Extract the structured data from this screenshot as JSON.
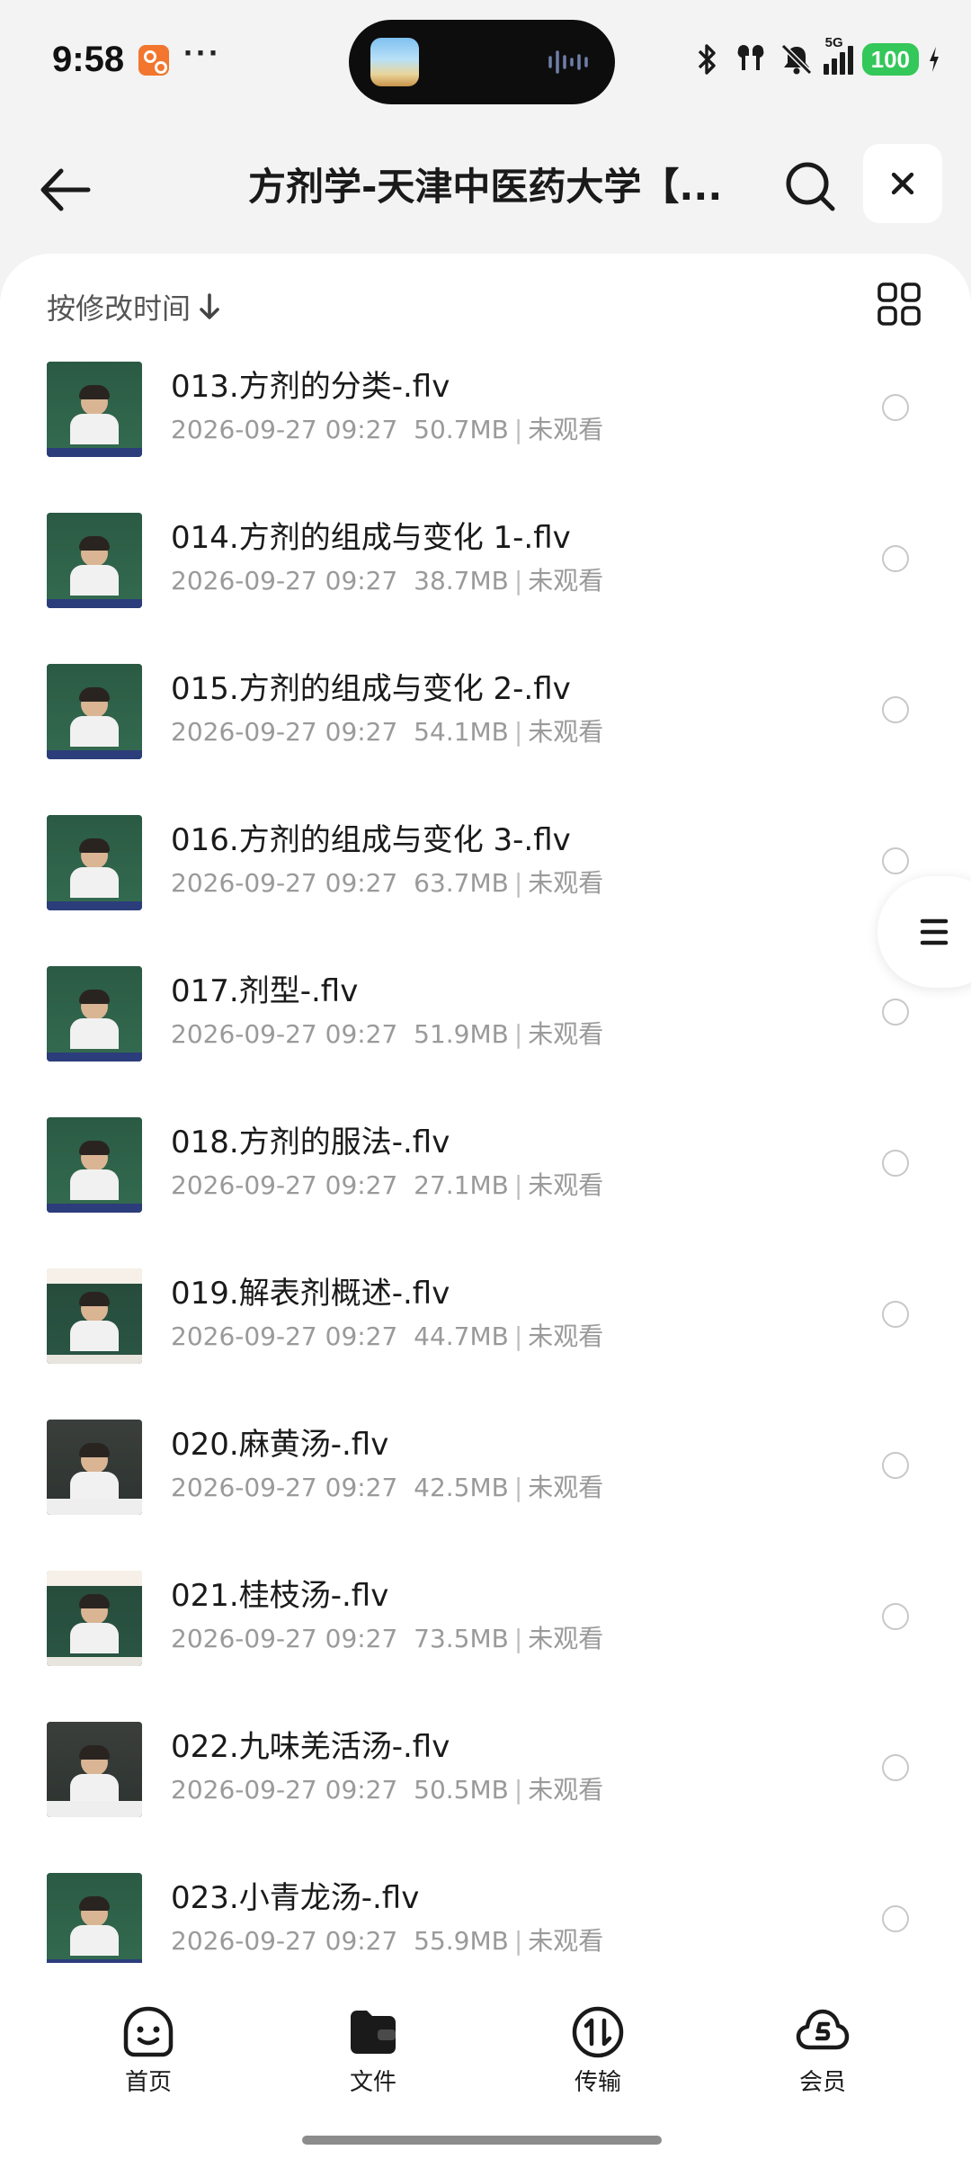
{
  "status_bar": {
    "time": "9:58",
    "more": "···",
    "network": "5G",
    "battery": "100"
  },
  "header": {
    "title": "方剂学-天津中医药大学【...",
    "back_icon": "arrow-left-icon",
    "search_icon": "search-icon",
    "close_icon": "close-icon"
  },
  "toolbar": {
    "sort_label": "按修改时间",
    "sort_icon": "arrow-down-icon",
    "view_icon": "grid-view-icon"
  },
  "files": [
    {
      "name": "013.方剂的分类-.flv",
      "date": "2026-09-27 09:27",
      "size": "50.7MB",
      "status": "未观看",
      "thumb": "green"
    },
    {
      "name": "014.方剂的组成与变化 1-.flv",
      "date": "2026-09-27 09:27",
      "size": "38.7MB",
      "status": "未观看",
      "thumb": "green"
    },
    {
      "name": "015.方剂的组成与变化 2-.flv",
      "date": "2026-09-27 09:27",
      "size": "54.1MB",
      "status": "未观看",
      "thumb": "green"
    },
    {
      "name": "016.方剂的组成与变化 3-.flv",
      "date": "2026-09-27 09:27",
      "size": "63.7MB",
      "status": "未观看",
      "thumb": "green"
    },
    {
      "name": "017.剂型-.flv",
      "date": "2026-09-27 09:27",
      "size": "51.9MB",
      "status": "未观看",
      "thumb": "green"
    },
    {
      "name": "018.方剂的服法-.flv",
      "date": "2026-09-27 09:27",
      "size": "27.1MB",
      "status": "未观看",
      "thumb": "green"
    },
    {
      "name": "019.解表剂概述-.flv",
      "date": "2026-09-27 09:27",
      "size": "44.7MB",
      "status": "未观看",
      "thumb": "light"
    },
    {
      "name": "020.麻黄汤-.flv",
      "date": "2026-09-27 09:27",
      "size": "42.5MB",
      "status": "未观看",
      "thumb": "dark"
    },
    {
      "name": "021.桂枝汤-.flv",
      "date": "2026-09-27 09:27",
      "size": "73.5MB",
      "status": "未观看",
      "thumb": "light"
    },
    {
      "name": "022.九味羌活汤-.flv",
      "date": "2026-09-27 09:27",
      "size": "50.5MB",
      "status": "未观看",
      "thumb": "dark"
    },
    {
      "name": "023.小青龙汤-.flv",
      "date": "2026-09-27 09:27",
      "size": "55.9MB",
      "status": "未观看",
      "thumb": "green"
    }
  ],
  "float_menu_icon": "menu-lines-icon",
  "bottom_nav": [
    {
      "label": "首页",
      "icon": "home-face-icon"
    },
    {
      "label": "文件",
      "icon": "folder-icon"
    },
    {
      "label": "传输",
      "icon": "transfer-icon"
    },
    {
      "label": "会员",
      "icon": "cloud-vip-icon"
    }
  ],
  "colors": {
    "battery": "#34c759",
    "notification_app": "#f2762e",
    "page_bg": "#f3f3f3",
    "card_bg": "#ffffff"
  }
}
